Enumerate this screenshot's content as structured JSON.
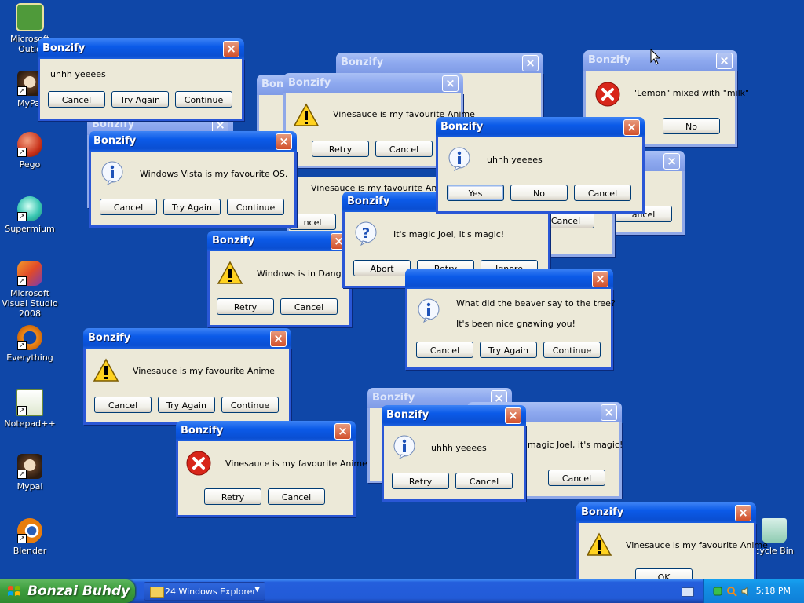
{
  "desktop_icons": [
    {
      "label": "Microsoft Outlo"
    },
    {
      "label": "MyPal"
    },
    {
      "label": "Pego"
    },
    {
      "label": "Supermium"
    },
    {
      "label": "Microsoft Visual Studio 2008"
    },
    {
      "label": "Everything"
    },
    {
      "label": "Notepad++"
    },
    {
      "label": "Mypal"
    },
    {
      "label": "Blender"
    },
    {
      "label": "cycle Bin"
    }
  ],
  "dialogs": {
    "title": "Bonzify",
    "close_glyph": "×",
    "d01": {
      "msg": "Vinesauce is my favourite Anime",
      "b1": "Retry",
      "b2": "Cancel"
    },
    "d02": {
      "msg": "",
      "b1": ""
    },
    "d03": {
      "msg": "\"Lemon\" mixed with \"milk\"",
      "b1": "No"
    },
    "d04": {
      "msg": "Vinesauce is my favourite Anime",
      "b1": "Retry",
      "b2": "Cancel"
    },
    "d05": {
      "msg": "Vinesauce is my favourite Anime",
      "b1": "ncel"
    },
    "d06": {
      "msg": "",
      "b1": "Cancel"
    },
    "d07": {
      "msg": "",
      "b1": "ancel"
    },
    "d08": {
      "msg": "uhhh yeeees",
      "b1": "Cancel",
      "b2": "Try Again",
      "b3": "Continue"
    },
    "d09": {
      "msg": "Windows Vista is my favourite OS.",
      "b1": "Cancel",
      "b2": "Try Again",
      "b3": "Continue"
    },
    "d10": {
      "msg": "It's magic Joel, it's magic!",
      "b1": "Abort",
      "b2": "Retry",
      "b3": "Ignore"
    },
    "d11": {
      "msg": "Windows is in Danger",
      "b1": "Retry",
      "b2": "Cancel"
    },
    "d12": {
      "msg1": "What did the beaver say to the tree?",
      "msg2": "It's been nice gnawing you!",
      "b1": "Cancel",
      "b2": "Try Again",
      "b3": "Continue"
    },
    "d13": {
      "msg": "uhhh yeeees",
      "b1": "Yes",
      "b2": "No",
      "b3": "Cancel"
    },
    "d14": {
      "msg": "Vinesauce is my favourite Anime",
      "b1": "Cancel",
      "b2": "Try Again",
      "b3": "Continue"
    },
    "d15": {
      "msg": "Vinesauce is my favourite Anime",
      "b1": "Retry",
      "b2": "Cancel"
    },
    "d16": {
      "msg": "magic Joel, it's magic!",
      "b1": "Cancel"
    },
    "d17": {
      "msg": "uhhh yeeees",
      "b1": "Retry",
      "b2": "Cancel"
    },
    "d18": {
      "msg": "Vinesauce is my favourite Anime",
      "b1": "OK"
    }
  },
  "taskbar": {
    "start_label": "Bonzai Buhdy",
    "task_button": "24 Windows Explorer",
    "clock": "5:18 PM"
  },
  "colors": {
    "desktop": "#0f47a8",
    "titlebar": "#0b5ae8",
    "dialog_bg": "#ece9d8",
    "start": "#3c9c3c"
  }
}
